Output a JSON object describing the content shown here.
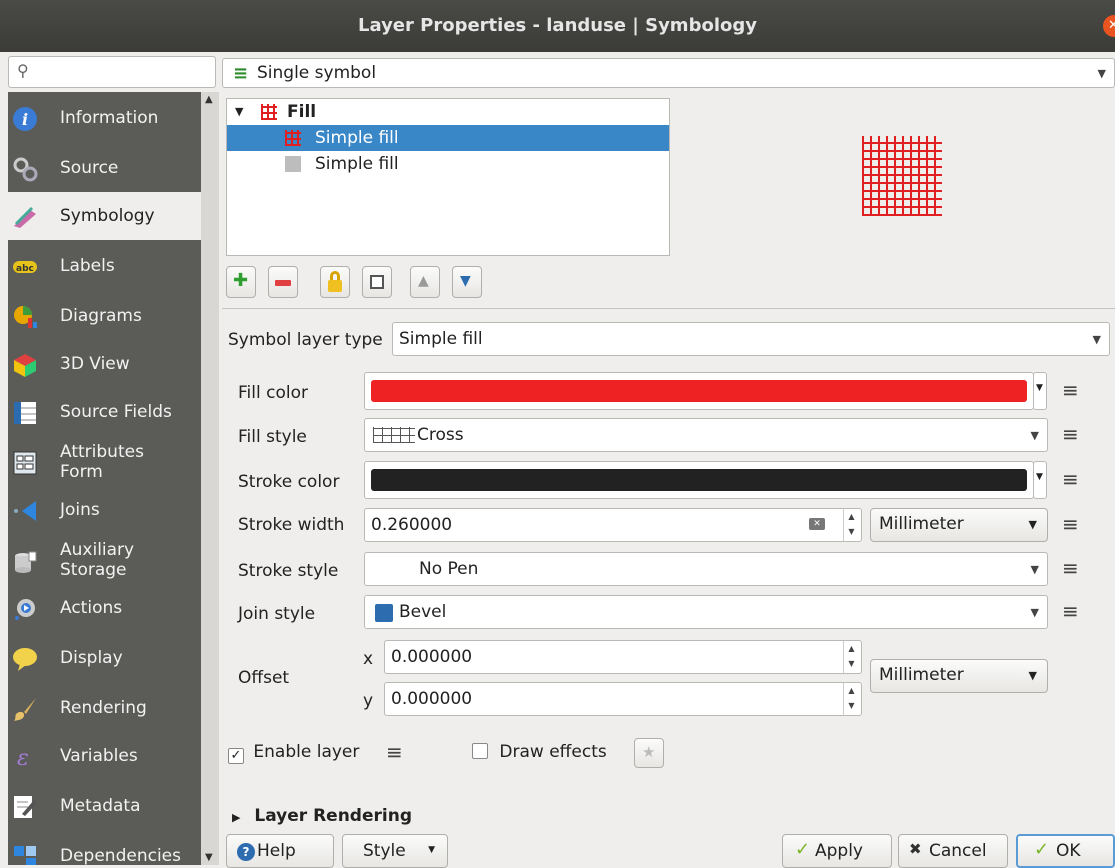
{
  "window": {
    "title": "Layer Properties - landuse | Symbology",
    "close_icon": "close-icon"
  },
  "search": {
    "placeholder": ""
  },
  "sidebar": {
    "items": [
      {
        "label": "Information",
        "icon": "info-icon",
        "color": "#3a7bd5"
      },
      {
        "label": "Source",
        "icon": "source-icon",
        "color": "#9aa"
      },
      {
        "label": "Symbology",
        "icon": "brush-icon",
        "color": "#b49"
      },
      {
        "label": "Labels",
        "icon": "abc-label-icon",
        "color": "#e5c31a"
      },
      {
        "label": "Diagrams",
        "icon": "pie-chart-icon",
        "color": "#e6a800"
      },
      {
        "label": "3D View",
        "icon": "cube-icon",
        "color": "#e04040"
      },
      {
        "label": "Source Fields",
        "icon": "table-icon",
        "color": "#2b6cb0"
      },
      {
        "label": "Attributes",
        "label2": "Form",
        "icon": "form-icon",
        "color": "#6aa"
      },
      {
        "label": "Joins",
        "icon": "joins-icon",
        "color": "#2e86de"
      },
      {
        "label": "Auxiliary",
        "label2": "Storage",
        "icon": "database-icon",
        "color": "#ccc"
      },
      {
        "label": "Actions",
        "icon": "gear-icon",
        "color": "#3a7bd5"
      },
      {
        "label": "Display",
        "icon": "speech-bubble-icon",
        "color": "#f1d24a"
      },
      {
        "label": "Rendering",
        "icon": "paintbrush-icon",
        "color": "#d9b05c"
      },
      {
        "label": "Variables",
        "icon": "epsilon-icon",
        "color": "#a47bd5"
      },
      {
        "label": "Metadata",
        "icon": "edit-document-icon",
        "color": "#ddd"
      },
      {
        "label": "Dependencies",
        "icon": "dependencies-icon",
        "color": "#2e86de"
      }
    ],
    "active_index": 2
  },
  "renderer": {
    "value": "Single symbol"
  },
  "symbol_tree": {
    "root": "Fill",
    "children": [
      "Simple fill",
      "Simple fill"
    ]
  },
  "symbol_layer_type": {
    "label": "Symbol layer type",
    "value": "Simple fill"
  },
  "props": {
    "fill_color_label": "Fill color",
    "fill_color": "#ee2222",
    "fill_style_label": "Fill style",
    "fill_style_value": "Cross",
    "stroke_color_label": "Stroke color",
    "stroke_color": "#222222",
    "stroke_width_label": "Stroke width",
    "stroke_width_value": "0.260000",
    "stroke_width_unit": "Millimeter",
    "stroke_style_label": "Stroke style",
    "stroke_style_value": "No Pen",
    "join_style_label": "Join style",
    "join_style_value": "Bevel",
    "offset_label": "Offset",
    "offset_x_label": "x",
    "offset_x_value": "0.000000",
    "offset_y_label": "y",
    "offset_y_value": "0.000000",
    "offset_unit": "Millimeter"
  },
  "options": {
    "enable_layer": "Enable layer",
    "draw_effects": "Draw effects",
    "layer_rendering": "Layer Rendering"
  },
  "footer": {
    "help": "Help",
    "style": "Style",
    "apply": "Apply",
    "cancel": "Cancel",
    "ok": "OK"
  }
}
